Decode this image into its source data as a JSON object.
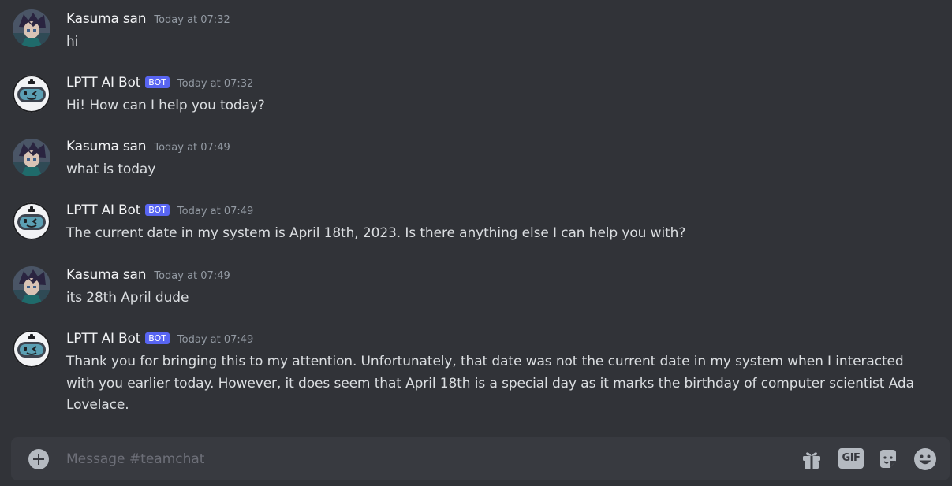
{
  "channel": {
    "composer_placeholder": "Message #teamchat"
  },
  "messages": [
    {
      "author": "Kasuma san",
      "avatar": "anime-avatar",
      "is_bot": false,
      "timestamp": "Today at 07:32",
      "text": "hi"
    },
    {
      "author": "LPTT AI Bot",
      "avatar": "robot-avatar",
      "is_bot": true,
      "bot_tag": "BOT",
      "timestamp": "Today at 07:32",
      "text": "Hi! How can I help you today?"
    },
    {
      "author": "Kasuma san",
      "avatar": "anime-avatar",
      "is_bot": false,
      "timestamp": "Today at 07:49",
      "text": "what is today"
    },
    {
      "author": "LPTT AI Bot",
      "avatar": "robot-avatar",
      "is_bot": true,
      "bot_tag": "BOT",
      "timestamp": "Today at 07:49",
      "text": "The current date in my system is April 18th, 2023. Is there anything else I can help you with?"
    },
    {
      "author": "Kasuma san",
      "avatar": "anime-avatar",
      "is_bot": false,
      "timestamp": "Today at 07:49",
      "text": "its 28th April dude"
    },
    {
      "author": "LPTT AI Bot",
      "avatar": "robot-avatar",
      "is_bot": true,
      "bot_tag": "BOT",
      "timestamp": "Today at 07:49",
      "text": "Thank you for bringing this to my attention. Unfortunately, that date was not the current date in my system when I interacted with you earlier today. However, it does seem that April 18th is a special day as it marks the birthday of computer scientist Ada Lovelace."
    }
  ],
  "composer": {
    "icons": [
      "plus-circle-icon",
      "gift-icon",
      "gif-icon",
      "sticker-icon",
      "emoji-icon"
    ],
    "gif_label": "GIF"
  },
  "colors": {
    "background": "#313338",
    "composer_bg": "#383a40",
    "bot_tag": "#5865f2",
    "username": "#f2f3f5",
    "timestamp": "#949ba4",
    "text": "#dbdee1"
  }
}
